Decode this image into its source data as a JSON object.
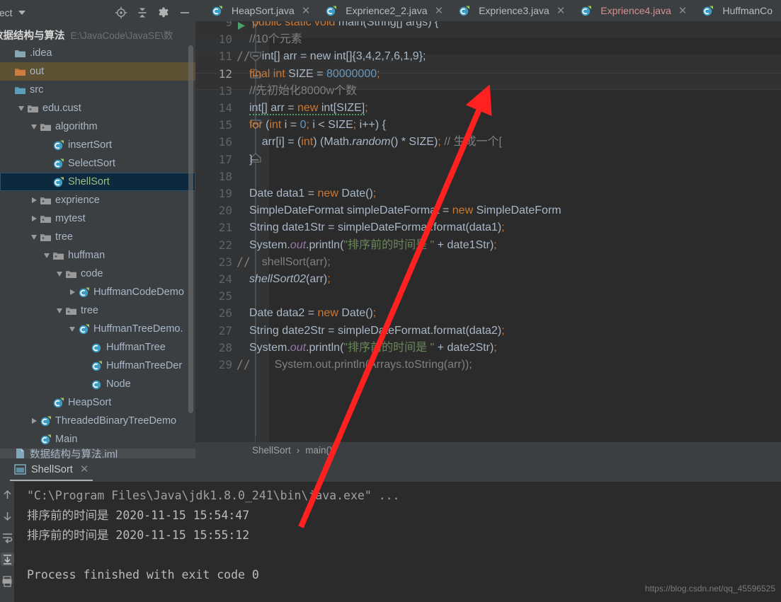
{
  "project_panel": {
    "title": "oject",
    "title_full": "Project",
    "tools": [
      "locate-icon",
      "collapse-all-icon",
      "settings-gear-icon",
      "minimize-icon"
    ],
    "root": {
      "label": "数据结构与算法",
      "path": "E:\\JavaCode\\JavaSE\\数"
    },
    "tree": [
      {
        "label": ".idea",
        "icon": "folder-icon",
        "indent": 0,
        "twisty": "none",
        "state": "normal"
      },
      {
        "label": "out",
        "icon": "folder-excluded-icon",
        "indent": 0,
        "twisty": "none",
        "state": "excluded"
      },
      {
        "label": "src",
        "icon": "folder-source-icon",
        "indent": 0,
        "twisty": "none",
        "state": "normal"
      },
      {
        "label": "edu.cust",
        "icon": "package-icon",
        "indent": 1,
        "twisty": "expanded",
        "state": "normal"
      },
      {
        "label": "algorithm",
        "icon": "package-icon",
        "indent": 2,
        "twisty": "expanded",
        "state": "normal"
      },
      {
        "label": "insertSort",
        "icon": "java-class-icon",
        "indent": 3,
        "twisty": "none",
        "state": "normal"
      },
      {
        "label": "SelectSort",
        "icon": "java-class-icon",
        "indent": 3,
        "twisty": "none",
        "state": "normal"
      },
      {
        "label": "ShellSort",
        "icon": "java-class-icon",
        "indent": 3,
        "twisty": "none",
        "state": "selected"
      },
      {
        "label": "exprience",
        "icon": "package-icon",
        "indent": 2,
        "twisty": "collapsed",
        "state": "normal"
      },
      {
        "label": "mytest",
        "icon": "package-icon",
        "indent": 2,
        "twisty": "collapsed",
        "state": "normal"
      },
      {
        "label": "tree",
        "icon": "package-icon",
        "indent": 2,
        "twisty": "expanded",
        "state": "normal"
      },
      {
        "label": "huffman",
        "icon": "package-icon",
        "indent": 3,
        "twisty": "expanded",
        "state": "normal"
      },
      {
        "label": "code",
        "icon": "package-icon",
        "indent": 4,
        "twisty": "expanded",
        "state": "normal"
      },
      {
        "label": "HuffmanCodeDemo",
        "icon": "java-class-icon",
        "indent": 5,
        "twisty": "collapsed",
        "state": "normal"
      },
      {
        "label": "tree",
        "icon": "package-icon",
        "indent": 4,
        "twisty": "expanded",
        "state": "normal"
      },
      {
        "label": "HuffmanTreeDemo.",
        "icon": "java-class-icon",
        "indent": 5,
        "twisty": "expanded",
        "state": "normal"
      },
      {
        "label": "HuffmanTree",
        "icon": "java-inner-class-icon",
        "indent": 6,
        "twisty": "none",
        "state": "normal"
      },
      {
        "label": "HuffmanTreeDer",
        "icon": "java-class-icon",
        "indent": 6,
        "twisty": "none",
        "state": "normal"
      },
      {
        "label": "Node",
        "icon": "java-inner-class-icon",
        "indent": 6,
        "twisty": "none",
        "state": "normal"
      },
      {
        "label": "HeapSort",
        "icon": "java-class-icon",
        "indent": 3,
        "twisty": "none",
        "state": "normal"
      },
      {
        "label": "ThreadedBinaryTreeDemo",
        "icon": "java-class-icon",
        "indent": 2,
        "twisty": "collapsed",
        "state": "normal"
      },
      {
        "label": "Main",
        "icon": "java-class-icon",
        "indent": 2,
        "twisty": "none",
        "state": "normal"
      },
      {
        "label": "数据结构与算法.iml",
        "icon": "iml-file-icon",
        "indent": 0,
        "twisty": "none",
        "state": "clipped"
      }
    ]
  },
  "editor": {
    "tabs": [
      {
        "label": "HeapSort.java",
        "modified": false
      },
      {
        "label": "Exprience2_2.java",
        "modified": false
      },
      {
        "label": "Exprience3.java",
        "modified": false
      },
      {
        "label": "Exprience4.java",
        "modified": true
      },
      {
        "label": "HuffmanCo",
        "modified": false
      }
    ],
    "breadcrumb": {
      "class": "ShellSort",
      "separator": "›",
      "method": "main()"
    },
    "lines": [
      {
        "num": "9",
        "marker": "",
        "current": false
      },
      {
        "num": "10",
        "marker": "",
        "current": false
      },
      {
        "num": "11",
        "marker": "//",
        "current": false
      },
      {
        "num": "12",
        "marker": "",
        "current": true
      },
      {
        "num": "13",
        "marker": "",
        "current": false
      },
      {
        "num": "14",
        "marker": "",
        "current": false
      },
      {
        "num": "15",
        "marker": "",
        "current": false
      },
      {
        "num": "16",
        "marker": "",
        "current": false
      },
      {
        "num": "17",
        "marker": "",
        "current": false
      },
      {
        "num": "18",
        "marker": "",
        "current": false
      },
      {
        "num": "19",
        "marker": "",
        "current": false
      },
      {
        "num": "20",
        "marker": "",
        "current": false
      },
      {
        "num": "21",
        "marker": "",
        "current": false
      },
      {
        "num": "22",
        "marker": "",
        "current": false
      },
      {
        "num": "23",
        "marker": "//",
        "current": false
      },
      {
        "num": "24",
        "marker": "",
        "current": false
      },
      {
        "num": "25",
        "marker": "",
        "current": false
      },
      {
        "num": "26",
        "marker": "",
        "current": false
      },
      {
        "num": "27",
        "marker": "",
        "current": false
      },
      {
        "num": "28",
        "marker": "",
        "current": false
      },
      {
        "num": "29",
        "marker": "//",
        "current": false
      }
    ],
    "code_text": {
      "l9": "public static void main(String[] args) {",
      "l10": "//10个元素",
      "l11": "int[] arr = new int[]{3,4,2,7,6,1,9};",
      "l12_kw": "final int",
      "l12_name": "SIZE = ",
      "l12_num": "80000000",
      "l13": "//先初始化8000w个数",
      "l14": "int[] arr = new int[SIZE];",
      "l15": "for (int i = 0; i < SIZE; i++) {",
      "l16": "arr[i] = (int) (Math.random() * SIZE); // 生成一个[",
      "l17": "}",
      "l19": "Date data1 = new Date();",
      "l20": "SimpleDateFormat simpleDateFormat = new SimpleDateForm",
      "l21": "String date1Str = simpleDateFormat.format(data1);",
      "l22": "System.out.println(\"排序前的时间是 \" + date1Str);",
      "l23": "shellSort(arr);",
      "l24": "shellSort02(arr);",
      "l26": "Date data2 = new Date();",
      "l27": "String date2Str = simpleDateFormat.format(data2);",
      "l28": "System.out.println(\"排序前的时间是 \" + date2Str);",
      "l29": "System.out.println(Arrays.toString(arr));"
    }
  },
  "console": {
    "tab_label": "ShellSort",
    "tab_close": "✕",
    "tools": [
      "arrow-up-icon",
      "arrow-down-icon",
      "soft-wrap-icon",
      "scroll-to-end-icon",
      "print-icon"
    ],
    "output": [
      {
        "text": "\"C:\\Program Files\\Java\\jdk1.8.0_241\\bin\\java.exe\" ...",
        "dim": true
      },
      {
        "text": "排序前的时间是 2020-11-15 15:54:47",
        "dim": false
      },
      {
        "text": "排序前的时间是 2020-11-15 15:55:12",
        "dim": false
      },
      {
        "text": "",
        "dim": false
      },
      {
        "text": "Process finished with exit code 0",
        "dim": false
      }
    ]
  },
  "watermark": "https://blog.csdn.net/qq_45596525",
  "colors": {
    "panel_bg": "#3c3f41",
    "editor_bg": "#2b2b2b",
    "gutter_bg": "#313335",
    "selection": "#0d293e",
    "excluded": "#5c5233",
    "keyword": "#cc7832",
    "number": "#6897bb",
    "string": "#6a8759",
    "comment": "#808080",
    "text": "#a9b7c6",
    "arrow": "#ff2a2a",
    "modified_tab": "#d98f8f"
  }
}
